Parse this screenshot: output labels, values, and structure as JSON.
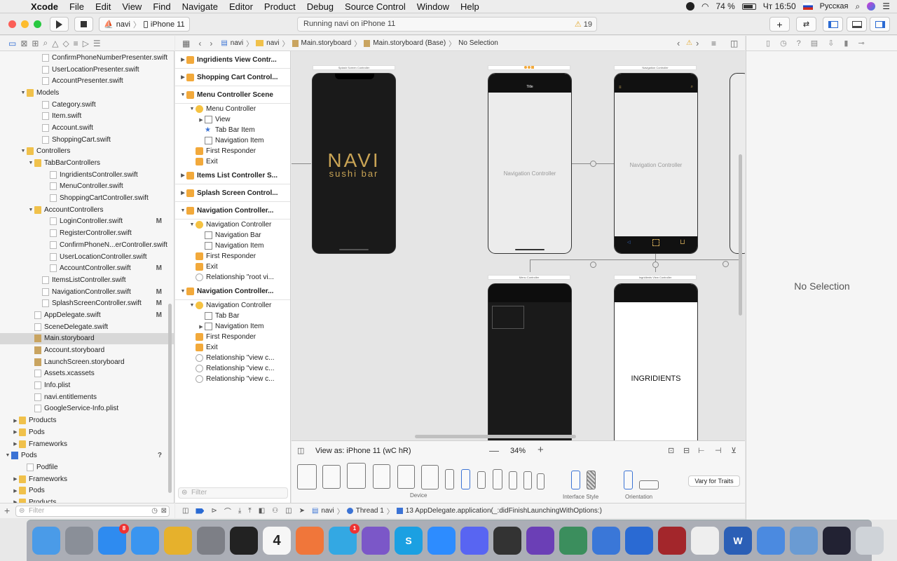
{
  "menubar": {
    "app": "Xcode",
    "items": [
      "File",
      "Edit",
      "View",
      "Find",
      "Navigate",
      "Editor",
      "Product",
      "Debug",
      "Source Control",
      "Window",
      "Help"
    ],
    "battery": "74 %",
    "clock": "Чт 16:50",
    "keyboard": "Русская"
  },
  "toolbar": {
    "scheme": "navi",
    "device": "iPhone 11",
    "activity": "Running navi on iPhone 11",
    "warnings": "19"
  },
  "navigator": {
    "items": [
      {
        "label": "ConfirmPhoneNumberPresenter.swift",
        "indent": 4,
        "kind": "file"
      },
      {
        "label": "UserLocationPresenter.swift",
        "indent": 4,
        "kind": "file"
      },
      {
        "label": "AccountPresenter.swift",
        "indent": 4,
        "kind": "file"
      },
      {
        "label": "Models",
        "indent": 2,
        "kind": "folder",
        "open": true
      },
      {
        "label": "Category.swift",
        "indent": 4,
        "kind": "file"
      },
      {
        "label": "Item.swift",
        "indent": 4,
        "kind": "file"
      },
      {
        "label": "Account.swift",
        "indent": 4,
        "kind": "file"
      },
      {
        "label": "ShoppingCart.swift",
        "indent": 4,
        "kind": "file"
      },
      {
        "label": "Controllers",
        "indent": 2,
        "kind": "folder",
        "open": true
      },
      {
        "label": "TabBarControllers",
        "indent": 3,
        "kind": "folder",
        "open": true
      },
      {
        "label": "IngridientsController.swift",
        "indent": 5,
        "kind": "file"
      },
      {
        "label": "MenuController.swift",
        "indent": 5,
        "kind": "file"
      },
      {
        "label": "ShoppingCartController.swift",
        "indent": 5,
        "kind": "file"
      },
      {
        "label": "AccountControllers",
        "indent": 3,
        "kind": "folder",
        "open": true
      },
      {
        "label": "LoginController.swift",
        "indent": 5,
        "kind": "file",
        "badge": "M"
      },
      {
        "label": "RegisterController.swift",
        "indent": 5,
        "kind": "file"
      },
      {
        "label": "ConfirmPhoneN...erController.swift",
        "indent": 5,
        "kind": "file"
      },
      {
        "label": "UserLocationController.swift",
        "indent": 5,
        "kind": "file"
      },
      {
        "label": "AccountController.swift",
        "indent": 5,
        "kind": "file",
        "badge": "M"
      },
      {
        "label": "ItemsListController.swift",
        "indent": 4,
        "kind": "file"
      },
      {
        "label": "NavigationController.swift",
        "indent": 4,
        "kind": "file",
        "badge": "M"
      },
      {
        "label": "SplashScreenController.swift",
        "indent": 4,
        "kind": "file",
        "badge": "M"
      },
      {
        "label": "AppDelegate.swift",
        "indent": 3,
        "kind": "file",
        "badge": "M"
      },
      {
        "label": "SceneDelegate.swift",
        "indent": 3,
        "kind": "file"
      },
      {
        "label": "Main.storyboard",
        "indent": 3,
        "kind": "sb",
        "selected": true
      },
      {
        "label": "Account.storyboard",
        "indent": 3,
        "kind": "sb"
      },
      {
        "label": "LaunchScreen.storyboard",
        "indent": 3,
        "kind": "sb"
      },
      {
        "label": "Assets.xcassets",
        "indent": 3,
        "kind": "file"
      },
      {
        "label": "Info.plist",
        "indent": 3,
        "kind": "file"
      },
      {
        "label": "navi.entitlements",
        "indent": 3,
        "kind": "file"
      },
      {
        "label": "GoogleService-Info.plist",
        "indent": 3,
        "kind": "file"
      },
      {
        "label": "Products",
        "indent": 1,
        "kind": "folder",
        "open": false
      },
      {
        "label": "Pods",
        "indent": 1,
        "kind": "folder",
        "open": false
      },
      {
        "label": "Frameworks",
        "indent": 1,
        "kind": "folder",
        "open": false
      },
      {
        "label": "Pods",
        "indent": 0,
        "kind": "proj",
        "open": true,
        "badge": "?"
      },
      {
        "label": "Podfile",
        "indent": 2,
        "kind": "file"
      },
      {
        "label": "Frameworks",
        "indent": 1,
        "kind": "folder",
        "open": false
      },
      {
        "label": "Pods",
        "indent": 1,
        "kind": "folder",
        "open": false
      },
      {
        "label": "Products",
        "indent": 1,
        "kind": "folder",
        "open": false
      }
    ],
    "filter_placeholder": "Filter"
  },
  "jumpbar": {
    "path": [
      "navi",
      "navi",
      "Main.storyboard",
      "Main.storyboard (Base)",
      "No Selection"
    ]
  },
  "outline": {
    "items": [
      {
        "label": "Ingridients View Contr...",
        "kind": "scene",
        "open": false
      },
      {
        "label": "Shopping Cart Control...",
        "kind": "scene",
        "open": false
      },
      {
        "label": "Menu Controller Scene",
        "kind": "scene",
        "open": true
      },
      {
        "label": "Menu Controller",
        "indent": 1,
        "kind": "vc",
        "open": true
      },
      {
        "label": "View",
        "indent": 2,
        "kind": "view",
        "tri": true
      },
      {
        "label": "Tab Bar Item",
        "indent": 2,
        "kind": "star"
      },
      {
        "label": "Navigation Item",
        "indent": 2,
        "kind": "navitem"
      },
      {
        "label": "First Responder",
        "indent": 1,
        "kind": "fr"
      },
      {
        "label": "Exit",
        "indent": 1,
        "kind": "exit"
      },
      {
        "label": "Items List Controller S...",
        "kind": "scene",
        "open": false
      },
      {
        "label": "Splash Screen Control...",
        "kind": "scene",
        "open": false
      },
      {
        "label": "Navigation Controller...",
        "kind": "scene",
        "open": true
      },
      {
        "label": "Navigation Controller",
        "indent": 1,
        "kind": "vc",
        "open": true
      },
      {
        "label": "Navigation Bar",
        "indent": 2,
        "kind": "view"
      },
      {
        "label": "Navigation Item",
        "indent": 2,
        "kind": "navitem"
      },
      {
        "label": "First Responder",
        "indent": 1,
        "kind": "fr"
      },
      {
        "label": "Exit",
        "indent": 1,
        "kind": "exit"
      },
      {
        "label": "Relationship \"root vi...",
        "indent": 1,
        "kind": "rel"
      },
      {
        "label": "Navigation Controller...",
        "kind": "scene",
        "open": true
      },
      {
        "label": "Navigation Controller",
        "indent": 1,
        "kind": "vc",
        "open": true
      },
      {
        "label": "Tab Bar",
        "indent": 2,
        "kind": "view"
      },
      {
        "label": "Navigation Item",
        "indent": 2,
        "kind": "navitem",
        "tri": true
      },
      {
        "label": "First Responder",
        "indent": 1,
        "kind": "fr"
      },
      {
        "label": "Exit",
        "indent": 1,
        "kind": "exit"
      },
      {
        "label": "Relationship \"view c...",
        "indent": 1,
        "kind": "rel"
      },
      {
        "label": "Relationship \"view c...",
        "indent": 1,
        "kind": "rel"
      },
      {
        "label": "Relationship \"view c...",
        "indent": 1,
        "kind": "rel"
      }
    ],
    "filter_placeholder": "Filter"
  },
  "canvas": {
    "splash_title": "Splash Screen Controller",
    "splash_logo": "NAVI",
    "splash_sub": "sushi bar",
    "nav1_title": "Title",
    "nav1_label": "Navigation Controller",
    "nav2_title": "Navigation Controller",
    "nav2_label": "Navigation Controller",
    "menu_title": "Menu Controller",
    "ingr_title": "Ingridients View Controller",
    "ingr_label": "INGRIDIENTS"
  },
  "bottom": {
    "view_as": "View as: iPhone 11 (wC hR)",
    "zoom": "34%",
    "device_label": "Device",
    "interface_style": "Interface Style",
    "orientation": "Orientation",
    "vary": "Vary for Traits"
  },
  "inspector": {
    "no_selection": "No Selection"
  },
  "debugbar": {
    "target": "navi",
    "thread": "Thread 1",
    "frame": "13 AppDelegate.application(_:didFinishLaunchingWithOptions:)"
  },
  "dock": {
    "apps": [
      {
        "name": "finder-icon",
        "color": "#4a9be8"
      },
      {
        "name": "launchpad-icon",
        "color": "#8a8f98"
      },
      {
        "name": "app-store-icon",
        "color": "#2e8bf0",
        "badge": "8"
      },
      {
        "name": "safari-icon",
        "color": "#3a95f0"
      },
      {
        "name": "chrome-icon",
        "color": "#e6b12c"
      },
      {
        "name": "system-preferences-icon",
        "color": "#7d7f86"
      },
      {
        "name": "terminal-icon",
        "color": "#222"
      },
      {
        "name": "calendar-icon",
        "color": "#f6f6f6",
        "text": "4"
      },
      {
        "name": "sketch-icon",
        "color": "#f0763a"
      },
      {
        "name": "telegram-icon",
        "color": "#33a8e3",
        "badge": "1"
      },
      {
        "name": "viber-icon",
        "color": "#7b57c8"
      },
      {
        "name": "skype-icon",
        "color": "#1ba0e2",
        "text": "S"
      },
      {
        "name": "zoom-icon",
        "color": "#2d8cff"
      },
      {
        "name": "discord-icon",
        "color": "#5865f2"
      },
      {
        "name": "unity-icon",
        "color": "#333"
      },
      {
        "name": "visual-studio-icon",
        "color": "#6b3fb6"
      },
      {
        "name": "android-studio-icon",
        "color": "#3b8e5d"
      },
      {
        "name": "instruments-icon",
        "color": "#3a77d8"
      },
      {
        "name": "xcode-icon",
        "color": "#2a6ad3"
      },
      {
        "name": "photo-booth-icon",
        "color": "#a3262b"
      },
      {
        "name": "textedit-icon",
        "color": "#eee"
      },
      {
        "name": "word-icon",
        "color": "#2b5fb6",
        "text": "W"
      },
      {
        "name": "simulator-icon",
        "color": "#4b8ae0"
      },
      {
        "name": "preview-icon",
        "color": "#6a9bd3"
      },
      {
        "name": "quicktime-icon",
        "color": "#223"
      },
      {
        "name": "trash-icon",
        "color": "#cfd3d8"
      }
    ]
  }
}
